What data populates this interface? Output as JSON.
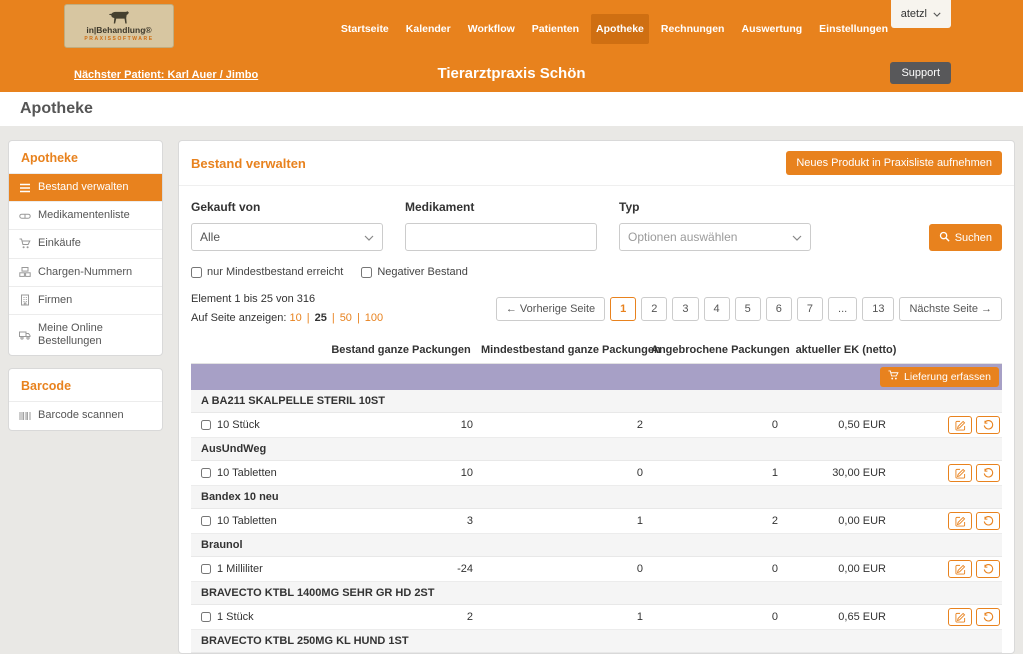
{
  "header": {
    "logo": {
      "title": "in|Behandlung®",
      "subtitle": "PRAXISSOFTWARE"
    },
    "nav": [
      {
        "label": "Startseite"
      },
      {
        "label": "Kalender"
      },
      {
        "label": "Workflow"
      },
      {
        "label": "Patienten"
      },
      {
        "label": "Apotheke",
        "active": true
      },
      {
        "label": "Rechnungen"
      },
      {
        "label": "Auswertung"
      },
      {
        "label": "Einstellungen"
      }
    ],
    "user": "atetzl",
    "next_patient": "Nächster Patient: Karl Auer / Jimbo",
    "practice_name": "Tierarztpraxis Schön",
    "support_label": "Support"
  },
  "page_title": "Apotheke",
  "sidebar": {
    "sections": [
      {
        "title": "Apotheke",
        "items": [
          {
            "label": "Bestand verwalten",
            "icon": "list",
            "active": true
          },
          {
            "label": "Medikamentenliste",
            "icon": "pills"
          },
          {
            "label": "Einkäufe",
            "icon": "cart"
          },
          {
            "label": "Chargen-Nummern",
            "icon": "boxes"
          },
          {
            "label": "Firmen",
            "icon": "building"
          },
          {
            "label": "Meine Online Bestellungen",
            "icon": "truck"
          }
        ]
      },
      {
        "title": "Barcode",
        "items": [
          {
            "label": "Barcode scannen",
            "icon": "barcode"
          }
        ]
      }
    ]
  },
  "main": {
    "title": "Bestand verwalten",
    "new_product_button": "Neues Produkt in Praxisliste aufnehmen",
    "filters": {
      "gekauft_von_label": "Gekauft von",
      "gekauft_von_value": "Alle",
      "medikament_label": "Medikament",
      "medikament_value": "",
      "typ_label": "Typ",
      "typ_placeholder": "Optionen auswählen",
      "search_label": "Suchen",
      "checkboxes": [
        "nur Mindestbestand erreicht",
        "Negativer Bestand"
      ]
    },
    "pagination": {
      "info": "Element 1 bis 25 von 316",
      "per_page_label": "Auf Seite anzeigen:",
      "separator": "|",
      "per_page": [
        {
          "label": "10"
        },
        {
          "label": "25",
          "active": true
        },
        {
          "label": "50"
        },
        {
          "label": "100"
        }
      ],
      "prev": "← Vorherige Seite",
      "pages": [
        {
          "label": "1",
          "current": true
        },
        {
          "label": "2"
        },
        {
          "label": "3"
        },
        {
          "label": "4"
        },
        {
          "label": "5"
        },
        {
          "label": "6"
        },
        {
          "label": "7"
        },
        {
          "label": "...",
          "ellipsis": true
        },
        {
          "label": "13"
        }
      ],
      "next": "Nächste Seite →"
    },
    "table": {
      "headers": [
        "Bestand ganze Packungen",
        "Mindestbestand ganze Packungen",
        "Angebrochene Packungen",
        "aktueller EK (netto)"
      ],
      "delivery_button": "Lieferung erfassen",
      "groups": [
        {
          "name": "A BA211 SKALPELLE STERIL 10ST",
          "rows": [
            {
              "unit": "10 Stück",
              "bestand": "10",
              "mindestbestand": "2",
              "angebrochen": "0",
              "ek": "0,50 EUR"
            }
          ]
        },
        {
          "name": "AusUndWeg",
          "rows": [
            {
              "unit": "10 Tabletten",
              "bestand": "10",
              "mindestbestand": "0",
              "angebrochen": "1",
              "ek": "30,00 EUR"
            }
          ]
        },
        {
          "name": "Bandex 10 neu",
          "rows": [
            {
              "unit": "10 Tabletten",
              "bestand": "3",
              "mindestbestand": "1",
              "angebrochen": "2",
              "ek": "0,00 EUR"
            }
          ]
        },
        {
          "name": "Braunol",
          "rows": [
            {
              "unit": "1 Milliliter",
              "bestand": "-24",
              "mindestbestand": "0",
              "angebrochen": "0",
              "ek": "0,00 EUR"
            }
          ]
        },
        {
          "name": "BRAVECTO KTBL 1400MG SEHR GR HD 2ST",
          "rows": [
            {
              "unit": "1 Stück",
              "bestand": "2",
              "mindestbestand": "1",
              "angebrochen": "0",
              "ek": "0,65 EUR"
            }
          ]
        },
        {
          "name": "BRAVECTO KTBL 250MG KL HUND 1ST",
          "rows": []
        }
      ]
    }
  },
  "colors": {
    "accent": "#e8821e",
    "nav_active": "#cf6f12",
    "table_band": "#a7a0c6"
  }
}
